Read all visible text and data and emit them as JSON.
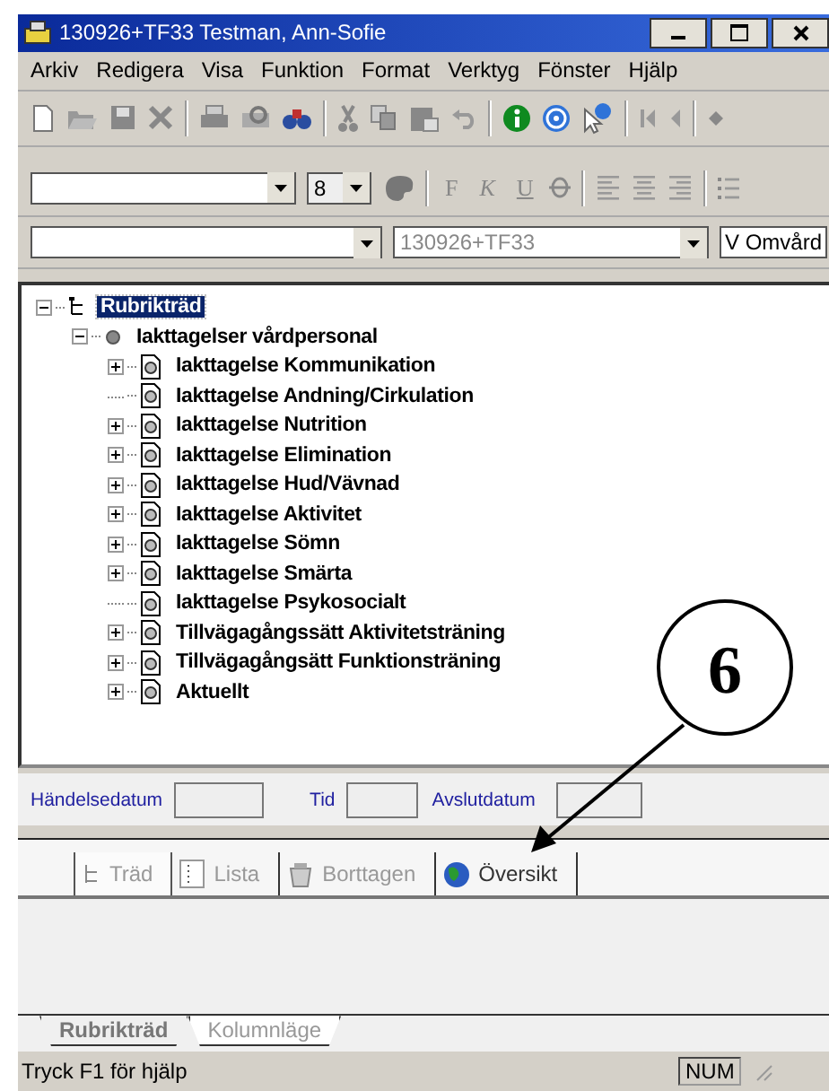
{
  "window": {
    "title": "130926+TF33 Testman, Ann-Sofie"
  },
  "menu": [
    "Arkiv",
    "Redigera",
    "Visa",
    "Funktion",
    "Format",
    "Verktyg",
    "Fönster",
    "Hjälp"
  ],
  "format_toolbar": {
    "size": "8",
    "styles": [
      {
        "label": "F"
      },
      {
        "label": "K"
      },
      {
        "label": "U"
      }
    ]
  },
  "selector_bar": {
    "patient": "130926+TF33",
    "unit": "V Omvård"
  },
  "tree": {
    "label": "Rubrikträd",
    "kind": "root",
    "selected": true,
    "expanded": true,
    "children": [
      {
        "label": "Iakttagelser vårdpersonal",
        "kind": "group",
        "selected": false,
        "expanded": true,
        "children": [
          {
            "label": "Iakttagelse Kommunikation",
            "kind": "document",
            "selected": false,
            "expanded": false,
            "expandable": true
          },
          {
            "label": "Iakttagelse Andning/Cirkulation",
            "kind": "document",
            "selected": false,
            "expanded": false,
            "expandable": false
          },
          {
            "label": "Iakttagelse Nutrition",
            "kind": "document",
            "selected": false,
            "expanded": false,
            "expandable": true
          },
          {
            "label": "Iakttagelse Elimination",
            "kind": "document",
            "selected": false,
            "expanded": false,
            "expandable": true
          },
          {
            "label": "Iakttagelse Hud/Vävnad",
            "kind": "document",
            "selected": false,
            "expanded": false,
            "expandable": true
          },
          {
            "label": "Iakttagelse Aktivitet",
            "kind": "document",
            "selected": false,
            "expanded": false,
            "expandable": true
          },
          {
            "label": "Iakttagelse Sömn",
            "kind": "document",
            "selected": false,
            "expanded": false,
            "expandable": true
          },
          {
            "label": "Iakttagelse Smärta",
            "kind": "document",
            "selected": false,
            "expanded": false,
            "expandable": true
          },
          {
            "label": "Iakttagelse Psykosocialt",
            "kind": "document",
            "selected": false,
            "expanded": false,
            "expandable": false
          },
          {
            "label": "Tillvägagångssätt Aktivitetsträning",
            "kind": "document",
            "selected": false,
            "expanded": false,
            "expandable": true
          },
          {
            "label": "Tillvägagångsätt Funktionsträning",
            "kind": "document",
            "selected": false,
            "expanded": false,
            "expandable": true
          },
          {
            "label": "Aktuellt",
            "kind": "document",
            "selected": false,
            "expanded": false,
            "expandable": true
          }
        ]
      }
    ]
  },
  "date_fields": [
    {
      "label": "Händelsedatum"
    },
    {
      "label": "Tid"
    },
    {
      "label": "Avslutdatum"
    }
  ],
  "view_tabs": [
    {
      "label": "Träd",
      "kind": "tree",
      "selected": true
    },
    {
      "label": "Lista",
      "kind": "list",
      "selected": false
    },
    {
      "label": "Borttagen",
      "kind": "trash",
      "selected": false
    },
    {
      "label": "Översikt",
      "kind": "globe",
      "selected": false
    }
  ],
  "sheet_tabs": [
    {
      "label": "Rubrikträd",
      "selected": true
    },
    {
      "label": "Kolumnläge",
      "selected": false
    }
  ],
  "status_bar": {
    "text": "Tryck F1 för hjälp",
    "indicator": "NUM"
  },
  "callout": {
    "label": "6"
  }
}
